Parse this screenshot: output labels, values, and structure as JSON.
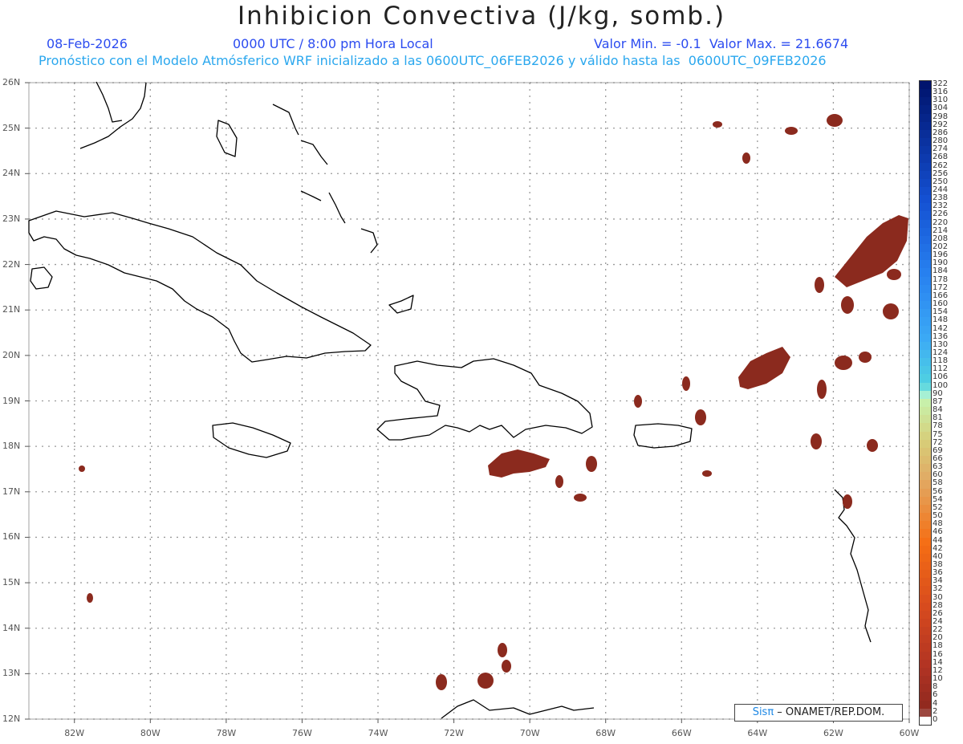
{
  "header": {
    "title": "Inhibicion Convectiva (J/kg, somb.)",
    "date": "08-Feb-2026",
    "time": "0000 UTC / 8:00 pm Hora Local",
    "minmax": "Valor Min. = -0.1  Valor Max. = 21.6674",
    "model_line": "Pronóstico con el Modelo Atmósferico WRF inicializado a las 0600UTC_06FEB2026 y válido hasta las  0600UTC_09FEB2026"
  },
  "axes": {
    "lat_labels": [
      "26N",
      "25N",
      "24N",
      "23N",
      "22N",
      "21N",
      "20N",
      "19N",
      "18N",
      "17N",
      "16N",
      "15N",
      "14N",
      "13N",
      "12N"
    ],
    "lon_labels": [
      "82W",
      "80W",
      "78W",
      "76W",
      "74W",
      "72W",
      "70W",
      "68W",
      "66W",
      "64W",
      "62W",
      "60W"
    ],
    "lat_range": [
      12,
      26
    ],
    "lon_range": [
      -83.2,
      -60
    ]
  },
  "colorbar": {
    "labels": [
      "322",
      "316",
      "310",
      "304",
      "298",
      "292",
      "286",
      "280",
      "274",
      "268",
      "262",
      "256",
      "250",
      "244",
      "238",
      "232",
      "226",
      "220",
      "214",
      "208",
      "202",
      "196",
      "190",
      "184",
      "178",
      "172",
      "166",
      "160",
      "154",
      "148",
      "142",
      "136",
      "130",
      "124",
      "118",
      "112",
      "106",
      "100",
      "90",
      "87",
      "84",
      "81",
      "78",
      "75",
      "72",
      "69",
      "66",
      "63",
      "60",
      "58",
      "56",
      "54",
      "52",
      "50",
      "48",
      "46",
      "44",
      "42",
      "40",
      "38",
      "36",
      "34",
      "32",
      "30",
      "28",
      "26",
      "24",
      "22",
      "20",
      "18",
      "16",
      "14",
      "12",
      "10",
      "8",
      "6",
      "4",
      "2",
      "0"
    ]
  },
  "colors": {
    "shade": "#8b2a1e",
    "grid": "#9a9a9a",
    "coast": "#000000",
    "header_blue": "#2c4cf0",
    "header_cyan": "#2aa7ee"
  },
  "credit": {
    "prefix": "Sisπ",
    "text": " – ONAMET/REP.DOM."
  }
}
